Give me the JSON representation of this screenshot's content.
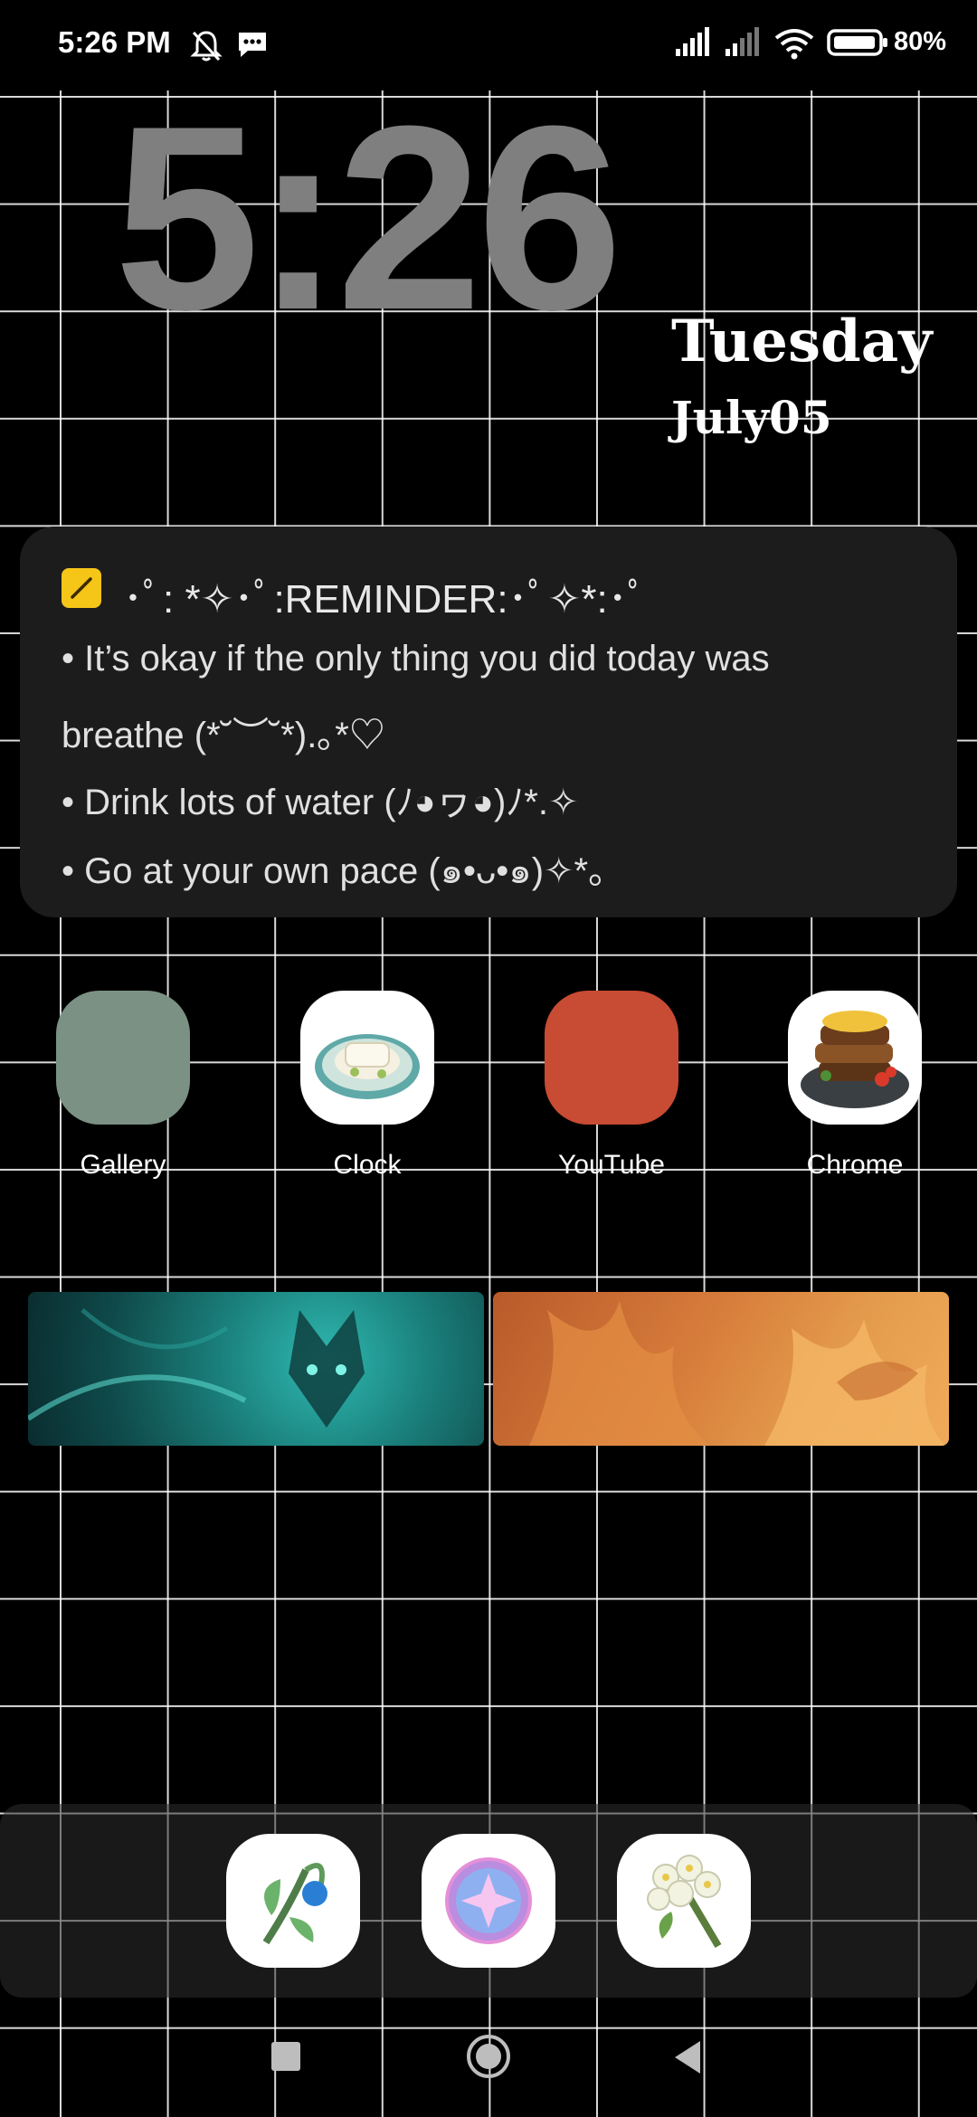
{
  "status_bar": {
    "time": "5:26 PM",
    "icons": [
      "bell-off-icon",
      "message-icon",
      "signal-icon",
      "signal-icon",
      "wifi-icon",
      "battery-icon"
    ],
    "battery": "80%"
  },
  "clock_widget": {
    "time": "5:26",
    "day": "Tuesday",
    "date": "July05"
  },
  "note_widget": {
    "icon": "pencil-icon",
    "title": "･ﾟ: *✧･ﾟ:REMINDER:･ﾟ✧*:･ﾟ",
    "lines": [
      "• It’s okay if the only thing you did today was",
      "breathe (*˘︶˘*).｡*♡",
      "• Drink lots of water (ﾉ◕ヮ◕)ﾉ*.✧",
      "• Go at your own pace (๑•ᴗ•๑)✧*。"
    ]
  },
  "apps": [
    {
      "label": "Gallery",
      "color": "#7b9183"
    },
    {
      "label": "Clock",
      "icon": "food-dish-icon"
    },
    {
      "label": "YouTube",
      "color": "#c84b33"
    },
    {
      "label": "Chrome",
      "icon": "food-dish-icon"
    }
  ],
  "dock": {
    "apps": [
      {
        "icon": "flower-icon"
      },
      {
        "icon": "crystal-orb-icon"
      },
      {
        "icon": "flower-icon"
      }
    ]
  },
  "nav_bar": {
    "buttons": [
      "recents-button",
      "home-button",
      "back-button"
    ]
  },
  "colors": {
    "background": "#000000",
    "grid": "#ffffff",
    "clock_gray": "#7f7f7f",
    "note_bg": "#1c1c1d",
    "note_icon": "#f5c518",
    "teal_banner": "#1b6b69",
    "orange_banner": "#d87e3c"
  }
}
